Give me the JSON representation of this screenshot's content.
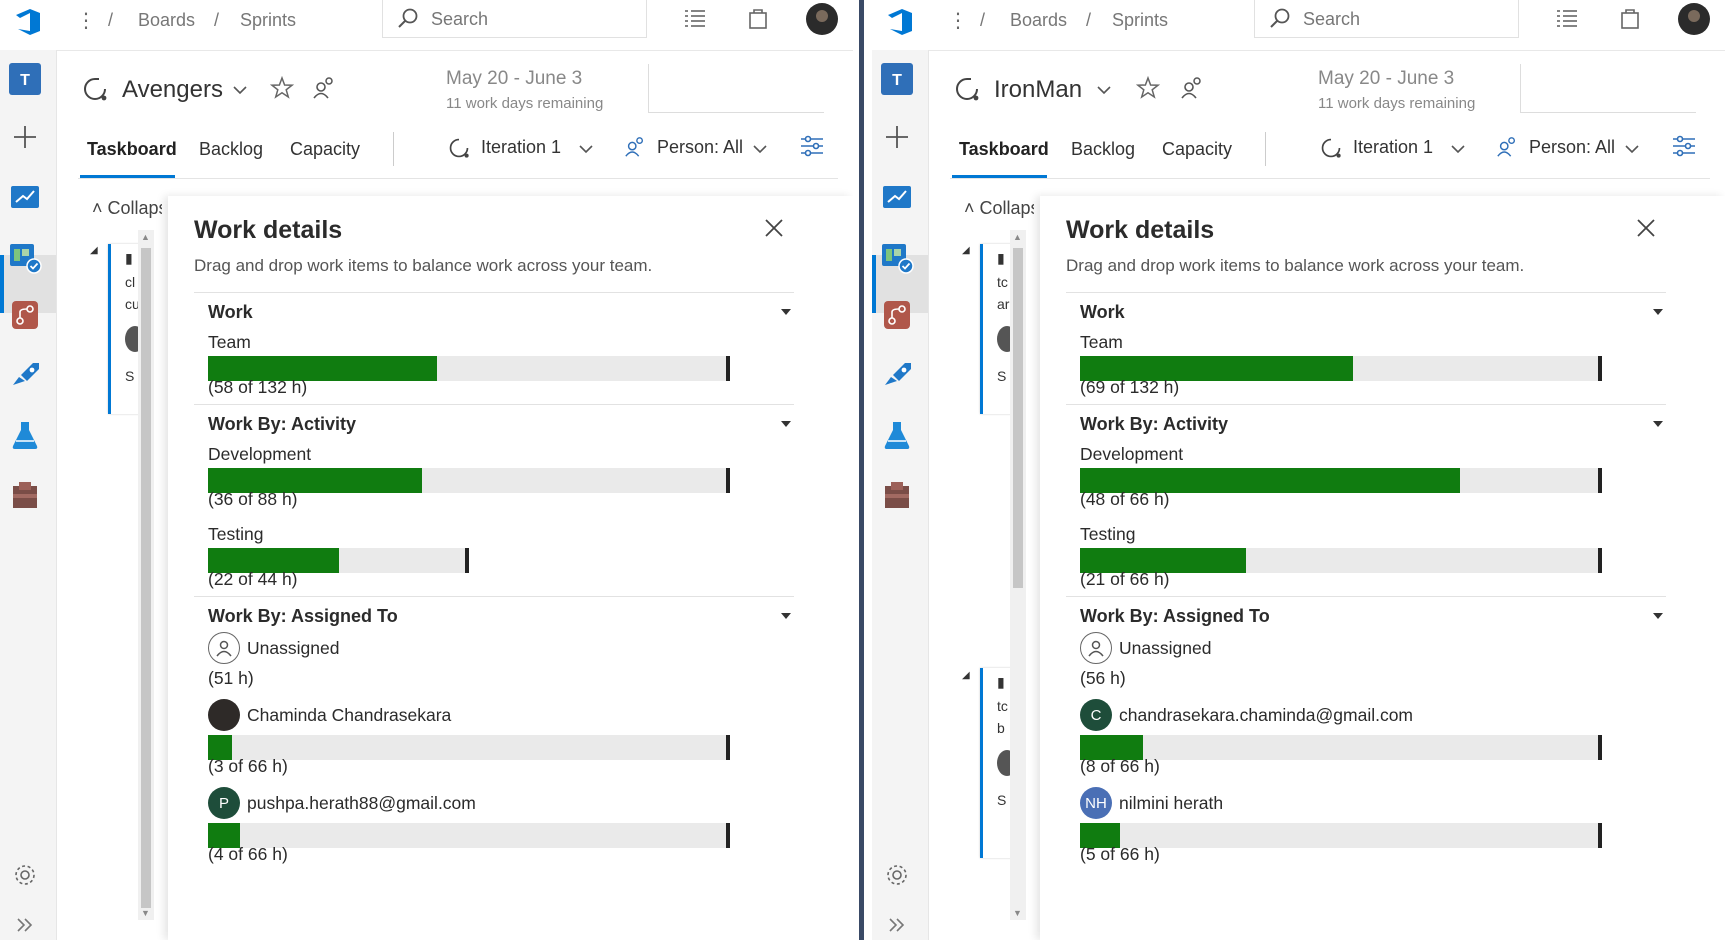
{
  "panels": [
    {
      "topbar": {
        "breadcrumb": [
          "Boards",
          "Sprints"
        ],
        "search_placeholder": "Search"
      },
      "header": {
        "team_name": "Avengers",
        "dates": "May 20 - June 3",
        "remaining": "11 work days remaining"
      },
      "tabs": [
        "Taskboard",
        "Backlog",
        "Capacity"
      ],
      "filters": {
        "iteration": "Iteration 1",
        "person": "Person: All"
      },
      "board": {
        "collapse_label": "Collapse",
        "card_lines": [
          "cl",
          "cu",
          "S"
        ]
      },
      "work_details": {
        "title": "Work details",
        "subtitle": "Drag and drop work items to balance work across your team.",
        "work": {
          "title": "Work",
          "team_label": "Team",
          "team_done": 58,
          "team_total": 132,
          "team_hours": "(58 of 132 h)"
        },
        "by_activity": {
          "title": "Work By: Activity",
          "items": [
            {
              "label": "Development",
              "done": 36,
              "total": 88,
              "text": "(36 of 88 h)",
              "bar_scale": 1.0
            },
            {
              "label": "Testing",
              "done": 22,
              "total": 44,
              "text": "(22 of 44 h)",
              "bar_scale": 0.5
            }
          ]
        },
        "by_assigned": {
          "title": "Work By: Assigned To",
          "unassigned": {
            "name": "Unassigned",
            "hours": "(51 h)"
          },
          "people": [
            {
              "name": "Chaminda Chandrasekara",
              "initials": "",
              "avatar_color": "#2e2a28",
              "done": 3,
              "total": 66,
              "text": "(3 of 66 h)"
            },
            {
              "name": "pushpa.herath88@gmail.com",
              "initials": "P",
              "avatar_color": "#1e4d3a",
              "done": 4,
              "total": 66,
              "text": "(4 of 66 h)"
            }
          ]
        }
      }
    },
    {
      "topbar": {
        "breadcrumb": [
          "Boards",
          "Sprints"
        ],
        "search_placeholder": "Search"
      },
      "header": {
        "team_name": "IronMan",
        "dates": "May 20 - June 3",
        "remaining": "11 work days remaining"
      },
      "tabs": [
        "Taskboard",
        "Backlog",
        "Capacity"
      ],
      "filters": {
        "iteration": "Iteration 1",
        "person": "Person: All"
      },
      "board": {
        "collapse_label": "Collapse",
        "card_lines": [
          "tc",
          "ar",
          "S"
        ]
      },
      "work_details": {
        "title": "Work details",
        "subtitle": "Drag and drop work items to balance work across your team.",
        "work": {
          "title": "Work",
          "team_label": "Team",
          "team_done": 69,
          "team_total": 132,
          "team_hours": "(69 of 132 h)"
        },
        "by_activity": {
          "title": "Work By: Activity",
          "items": [
            {
              "label": "Development",
              "done": 48,
              "total": 66,
              "text": "(48 of 66 h)",
              "bar_scale": 1.0
            },
            {
              "label": "Testing",
              "done": 21,
              "total": 66,
              "text": "(21 of 66 h)",
              "bar_scale": 1.0
            }
          ]
        },
        "by_assigned": {
          "title": "Work By: Assigned To",
          "unassigned": {
            "name": "Unassigned",
            "hours": "(56 h)"
          },
          "people": [
            {
              "name": "chandrasekara.chaminda@gmail.com",
              "initials": "C",
              "avatar_color": "#1e4d3a",
              "done": 8,
              "total": 66,
              "text": "(8 of 66 h)"
            },
            {
              "name": "nilmini herath",
              "initials": "NH",
              "avatar_color": "#4a6fb5",
              "done": 5,
              "total": 66,
              "text": "(5 of 66 h)"
            }
          ]
        }
      }
    }
  ],
  "colors": {
    "accent": "#0078d4",
    "progress": "#107c10",
    "track": "#eaeaea"
  }
}
